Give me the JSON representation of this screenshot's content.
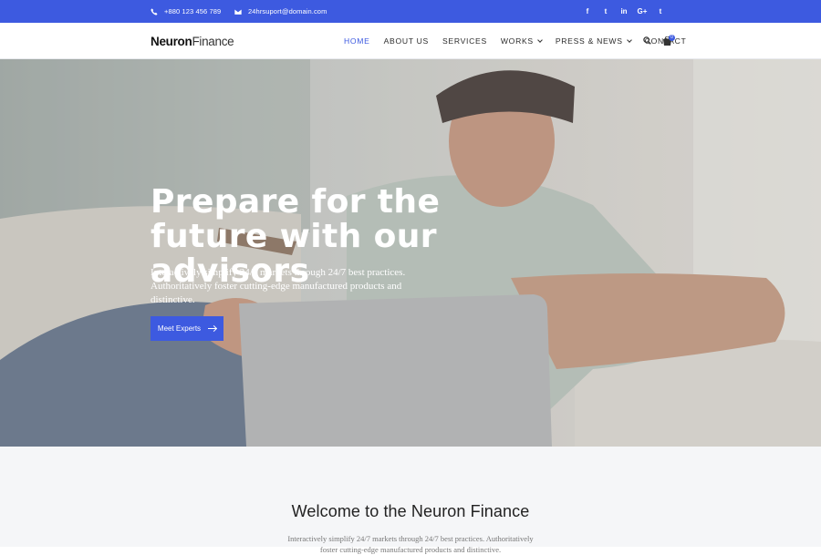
{
  "topbar": {
    "phone": "+880 123 456 789",
    "email": "24hrsuport@domain.com",
    "social": [
      {
        "icon": "facebook-icon",
        "glyph": "f"
      },
      {
        "icon": "twitter-icon",
        "glyph": "t"
      },
      {
        "icon": "linkedin-icon",
        "glyph": "in"
      },
      {
        "icon": "google-plus-icon",
        "glyph": "G+"
      },
      {
        "icon": "tumblr-icon",
        "glyph": "t"
      }
    ]
  },
  "navbar": {
    "logo_bold": "Neuron",
    "logo_light": "Finance",
    "items": [
      {
        "label": "HOME",
        "active": true,
        "dropdown": false
      },
      {
        "label": "ABOUT US",
        "active": false,
        "dropdown": false
      },
      {
        "label": "SERVICES",
        "active": false,
        "dropdown": false
      },
      {
        "label": "WORKS",
        "active": false,
        "dropdown": true
      },
      {
        "label": "PRESS & NEWS",
        "active": false,
        "dropdown": true
      },
      {
        "label": "CONTACT",
        "active": false,
        "dropdown": false
      }
    ],
    "cart_count": "0"
  },
  "hero": {
    "title": "Prepare for the future with our advisors",
    "text": "Interactively simplify 24/7 markets through 24/7 best practices. Authoritatively foster cutting-edge manufactured products and distinctive.",
    "button_label": "Meet Experts"
  },
  "welcome": {
    "title": "Welcome to the Neuron Finance",
    "text": "Interactively simplify 24/7 markets through 24/7 best practices. Authoritatively foster cutting-edge manufactured products and distinctive."
  },
  "colors": {
    "accent": "#3d5ae0",
    "section_bg": "#f5f6f8"
  }
}
